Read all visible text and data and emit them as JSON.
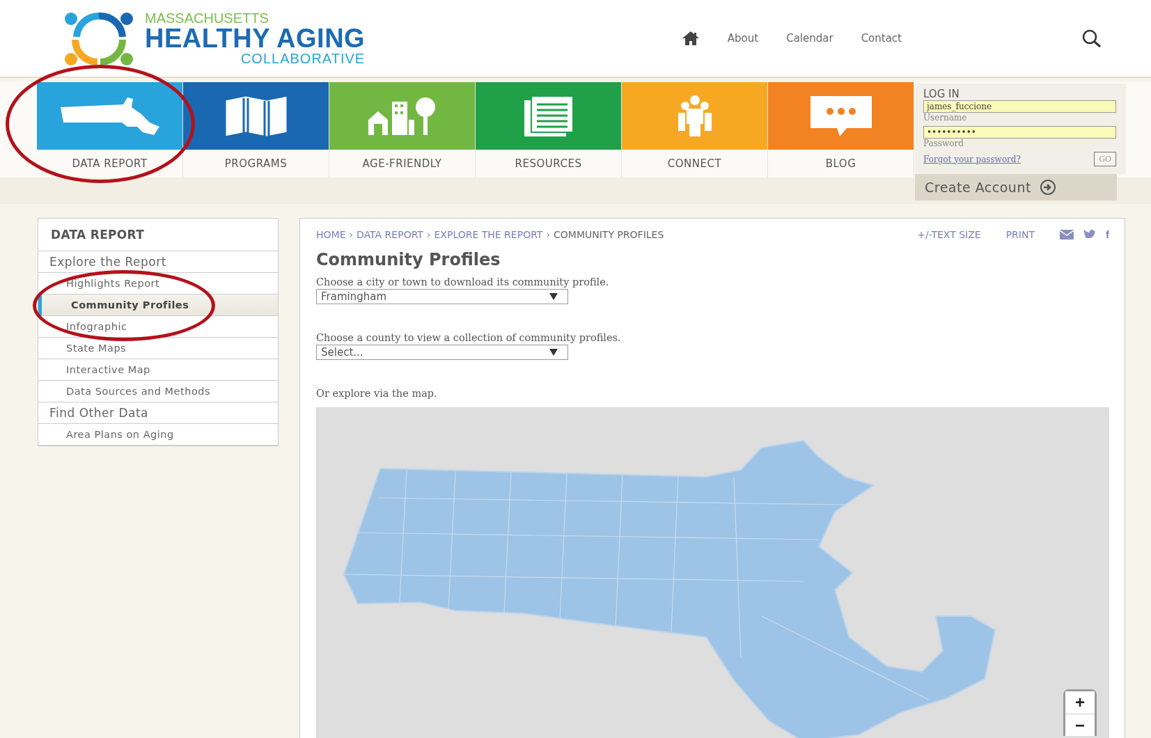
{
  "logo": {
    "line_1": "MASSACHUSETTS",
    "line_2": "HEALTHY AGING",
    "line_3": "COLLABORATIVE"
  },
  "top_links": [
    "About",
    "Calendar",
    "Contact"
  ],
  "nav_tiles": [
    {
      "label": "DATA REPORT",
      "kind": "state-map",
      "color": "#29a3dc",
      "circled": true
    },
    {
      "label": "PROGRAMS",
      "kind": "folded-map",
      "color": "#1a68b2",
      "circled": false
    },
    {
      "label": "AGE-FRIENDLY",
      "kind": "town",
      "color": "#73b743",
      "circled": false
    },
    {
      "label": "RESOURCES",
      "kind": "documents",
      "color": "#21a04a",
      "circled": false
    },
    {
      "label": "CONNECT",
      "kind": "people",
      "color": "#f7a823",
      "circled": false
    },
    {
      "label": "BLOG",
      "kind": "speech",
      "color": "#f28222",
      "circled": false
    }
  ],
  "login": {
    "title": "LOG IN",
    "username": "james_fuccione",
    "username_label": "Username",
    "password": "••••••••••",
    "password_label": "Password",
    "forgot_link": "Forgot your password?",
    "go_button": "GO",
    "create_account": "Create Account"
  },
  "sidebar": {
    "title": "DATA REPORT",
    "items": [
      {
        "label": "Explore the Report",
        "kind": "section",
        "selected": false,
        "circled": false
      },
      {
        "label": "Highlights Report",
        "kind": "sub",
        "selected": false,
        "circled": false
      },
      {
        "label": "Community Profiles",
        "kind": "sub",
        "selected": true,
        "circled": true
      },
      {
        "label": "Infographic",
        "kind": "sub",
        "selected": false,
        "circled": false
      },
      {
        "label": "State Maps",
        "kind": "sub",
        "selected": false,
        "circled": false
      },
      {
        "label": "Interactive Map",
        "kind": "sub",
        "selected": false,
        "circled": false
      },
      {
        "label": "Data Sources and Methods",
        "kind": "sub",
        "selected": false,
        "circled": false
      },
      {
        "label": "Find Other Data",
        "kind": "section",
        "selected": false,
        "circled": false
      },
      {
        "label": "Area Plans on Aging",
        "kind": "sub",
        "selected": false,
        "circled": false
      }
    ]
  },
  "breadcrumb": {
    "separator": "›",
    "items": [
      {
        "label": "HOME",
        "selected": false
      },
      {
        "label": "DATA REPORT",
        "selected": false
      },
      {
        "label": "EXPLORE THE REPORT",
        "selected": false
      },
      {
        "label": "COMMUNITY PROFILES",
        "selected": true
      }
    ]
  },
  "tools": {
    "text_size": "+/-TEXT SIZE",
    "print": "PRINT",
    "facebook": "f"
  },
  "heading": "Community Profiles",
  "city_select": {
    "label": "Choose a city or town to download its community profile.",
    "value": "Framingham"
  },
  "county_select": {
    "label": "Choose a county to view a collection of community profiles.",
    "value": "Select..."
  },
  "map_prompt": "Or explore via the map.",
  "zoom_controls": [
    "+",
    "−"
  ]
}
